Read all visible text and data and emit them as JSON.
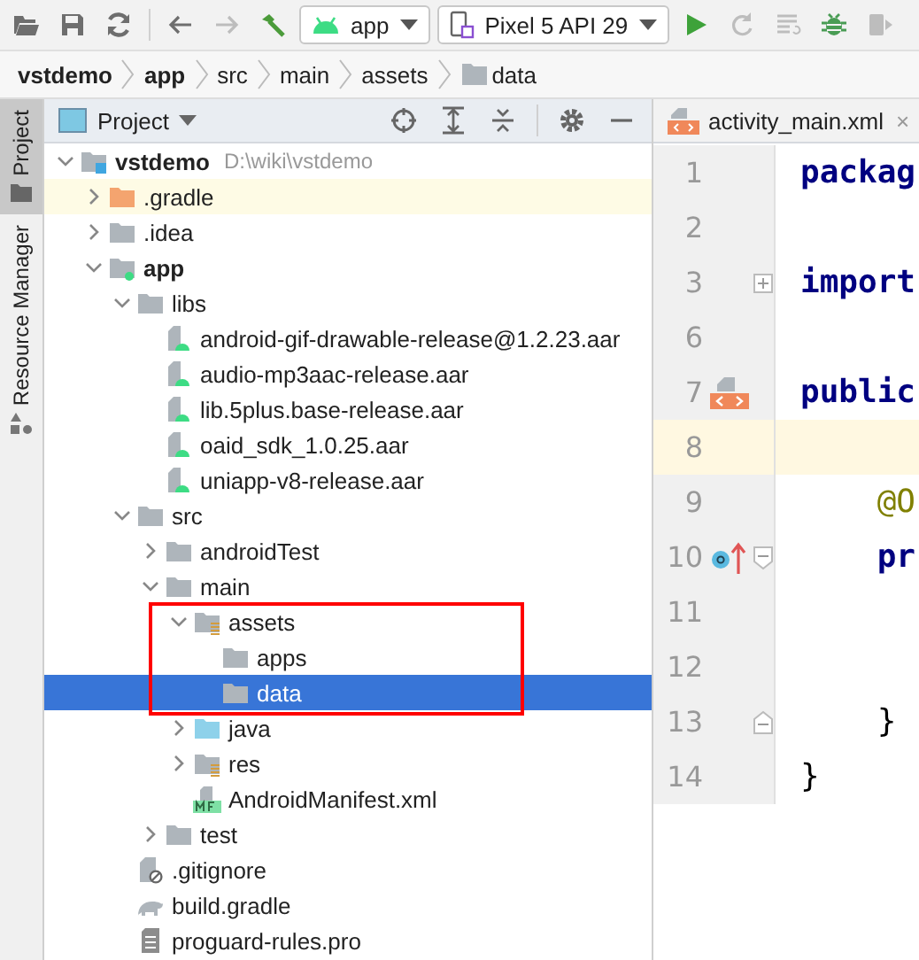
{
  "toolbar": {
    "buttons": [
      {
        "kind": "open",
        "disabled": false
      },
      {
        "kind": "save",
        "disabled": false
      },
      {
        "kind": "sync",
        "disabled": false
      },
      {
        "kind": "back",
        "disabled": false
      },
      {
        "kind": "forward",
        "disabled": true
      },
      {
        "kind": "build",
        "disabled": false
      }
    ],
    "run_config": {
      "label": "app"
    },
    "device": {
      "label": "Pixel 5 API 29"
    },
    "actions": [
      {
        "kind": "run",
        "disabled": false
      },
      {
        "kind": "apply",
        "disabled": true
      },
      {
        "kind": "apply-code",
        "disabled": true
      },
      {
        "kind": "debug",
        "disabled": false
      },
      {
        "kind": "profile",
        "disabled": true
      }
    ]
  },
  "breadcrumbs": [
    {
      "label": "vstdemo",
      "bold": true,
      "kind": "text"
    },
    {
      "label": "app",
      "bold": true,
      "kind": "text"
    },
    {
      "label": "src",
      "bold": false,
      "kind": "text"
    },
    {
      "label": "main",
      "bold": false,
      "kind": "text"
    },
    {
      "label": "assets",
      "bold": false,
      "kind": "text"
    },
    {
      "label": "data",
      "bold": false,
      "kind": "folder"
    }
  ],
  "side_tabs": [
    {
      "label": "Project",
      "selected": true
    },
    {
      "label": "Resource Manager",
      "selected": false
    }
  ],
  "project_panel": {
    "title": "Project",
    "tree": [
      {
        "name": "vstdemo",
        "path": "D:\\wiki\\vstdemo",
        "kind": "project",
        "bold": true,
        "expanded": true,
        "selected": false,
        "highlighted": false,
        "framed": false,
        "children": [
          {
            "name": ".gradle",
            "kind": "excluded",
            "bold": false,
            "expanded": false,
            "selected": false,
            "highlighted": true,
            "framed": false
          },
          {
            "name": ".idea",
            "kind": "folder",
            "bold": false,
            "expanded": false,
            "selected": false,
            "highlighted": false,
            "framed": false
          },
          {
            "name": "app",
            "kind": "module",
            "bold": true,
            "expanded": true,
            "selected": false,
            "highlighted": false,
            "framed": false,
            "children": [
              {
                "name": "libs",
                "kind": "folder",
                "bold": false,
                "expanded": true,
                "selected": false,
                "highlighted": false,
                "framed": false,
                "children": [
                  {
                    "name": "android-gif-drawable-release@1.2.23.aar",
                    "kind": "archive",
                    "bold": false,
                    "selected": false,
                    "highlighted": false,
                    "framed": false
                  },
                  {
                    "name": "audio-mp3aac-release.aar",
                    "kind": "archive",
                    "bold": false,
                    "selected": false,
                    "highlighted": false,
                    "framed": false
                  },
                  {
                    "name": "lib.5plus.base-release.aar",
                    "kind": "archive",
                    "bold": false,
                    "selected": false,
                    "highlighted": false,
                    "framed": false
                  },
                  {
                    "name": "oaid_sdk_1.0.25.aar",
                    "kind": "archive",
                    "bold": false,
                    "selected": false,
                    "highlighted": false,
                    "framed": false
                  },
                  {
                    "name": "uniapp-v8-release.aar",
                    "kind": "archive",
                    "bold": false,
                    "selected": false,
                    "highlighted": false,
                    "framed": false
                  }
                ]
              },
              {
                "name": "src",
                "kind": "folder",
                "bold": false,
                "expanded": true,
                "selected": false,
                "highlighted": false,
                "framed": false,
                "children": [
                  {
                    "name": "androidTest",
                    "kind": "folder",
                    "bold": false,
                    "expanded": false,
                    "selected": false,
                    "highlighted": false,
                    "framed": false
                  },
                  {
                    "name": "main",
                    "kind": "folder",
                    "bold": false,
                    "expanded": true,
                    "selected": false,
                    "highlighted": false,
                    "framed": false,
                    "children": [
                      {
                        "name": "assets",
                        "kind": "resources",
                        "bold": false,
                        "expanded": true,
                        "selected": false,
                        "highlighted": false,
                        "framed": true,
                        "children": [
                          {
                            "name": "apps",
                            "kind": "folder",
                            "bold": false,
                            "selected": false,
                            "highlighted": false,
                            "framed": true
                          },
                          {
                            "name": "data",
                            "kind": "folder",
                            "bold": false,
                            "selected": true,
                            "highlighted": false,
                            "framed": true
                          }
                        ]
                      },
                      {
                        "name": "java",
                        "kind": "source",
                        "bold": false,
                        "expanded": false,
                        "selected": false,
                        "highlighted": false,
                        "framed": false
                      },
                      {
                        "name": "res",
                        "kind": "resources",
                        "bold": false,
                        "expanded": false,
                        "selected": false,
                        "highlighted": false,
                        "framed": false
                      },
                      {
                        "name": "AndroidManifest.xml",
                        "kind": "manifest",
                        "bold": false,
                        "selected": false,
                        "highlighted": false,
                        "framed": false
                      }
                    ]
                  },
                  {
                    "name": "test",
                    "kind": "folder",
                    "bold": false,
                    "expanded": false,
                    "selected": false,
                    "highlighted": false,
                    "framed": false
                  }
                ]
              },
              {
                "name": ".gitignore",
                "kind": "ignore",
                "bold": false,
                "selected": false,
                "highlighted": false,
                "framed": false
              },
              {
                "name": "build.gradle",
                "kind": "gradle",
                "bold": false,
                "selected": false,
                "highlighted": false,
                "framed": false
              },
              {
                "name": "proguard-rules.pro",
                "kind": "text",
                "bold": false,
                "selected": false,
                "highlighted": false,
                "framed": false
              }
            ]
          }
        ]
      }
    ]
  },
  "editor": {
    "tab": {
      "label": "activity_main.xml",
      "close": "×"
    },
    "lines": [
      {
        "number": "1",
        "code": "packag",
        "kind": "keyword",
        "current": false
      },
      {
        "number": "2",
        "current": false
      },
      {
        "number": "3",
        "code": "import",
        "kind": "keyword",
        "current": false,
        "fold_mark": {
          "kind": "collapsed"
        }
      },
      {
        "number": "6",
        "current": false
      },
      {
        "number": "7",
        "code": "public",
        "kind": "keyword",
        "current": false,
        "gutter_mark": {
          "kind": "layout"
        }
      },
      {
        "number": "8",
        "current": true
      },
      {
        "number": "9",
        "code": "    @O",
        "kind": "annotation",
        "current": false
      },
      {
        "number": "10",
        "code": "    pr",
        "kind": "keyword",
        "current": false,
        "gutter_mark": {
          "kind": "override"
        },
        "fold_mark": {
          "kind": "start"
        }
      },
      {
        "number": "11",
        "current": false
      },
      {
        "number": "12",
        "current": false
      },
      {
        "number": "13",
        "code": "    }",
        "kind": "plain",
        "current": false,
        "fold_mark": {
          "kind": "end"
        }
      },
      {
        "number": "14",
        "code": "}",
        "kind": "plain",
        "current": false
      }
    ]
  }
}
